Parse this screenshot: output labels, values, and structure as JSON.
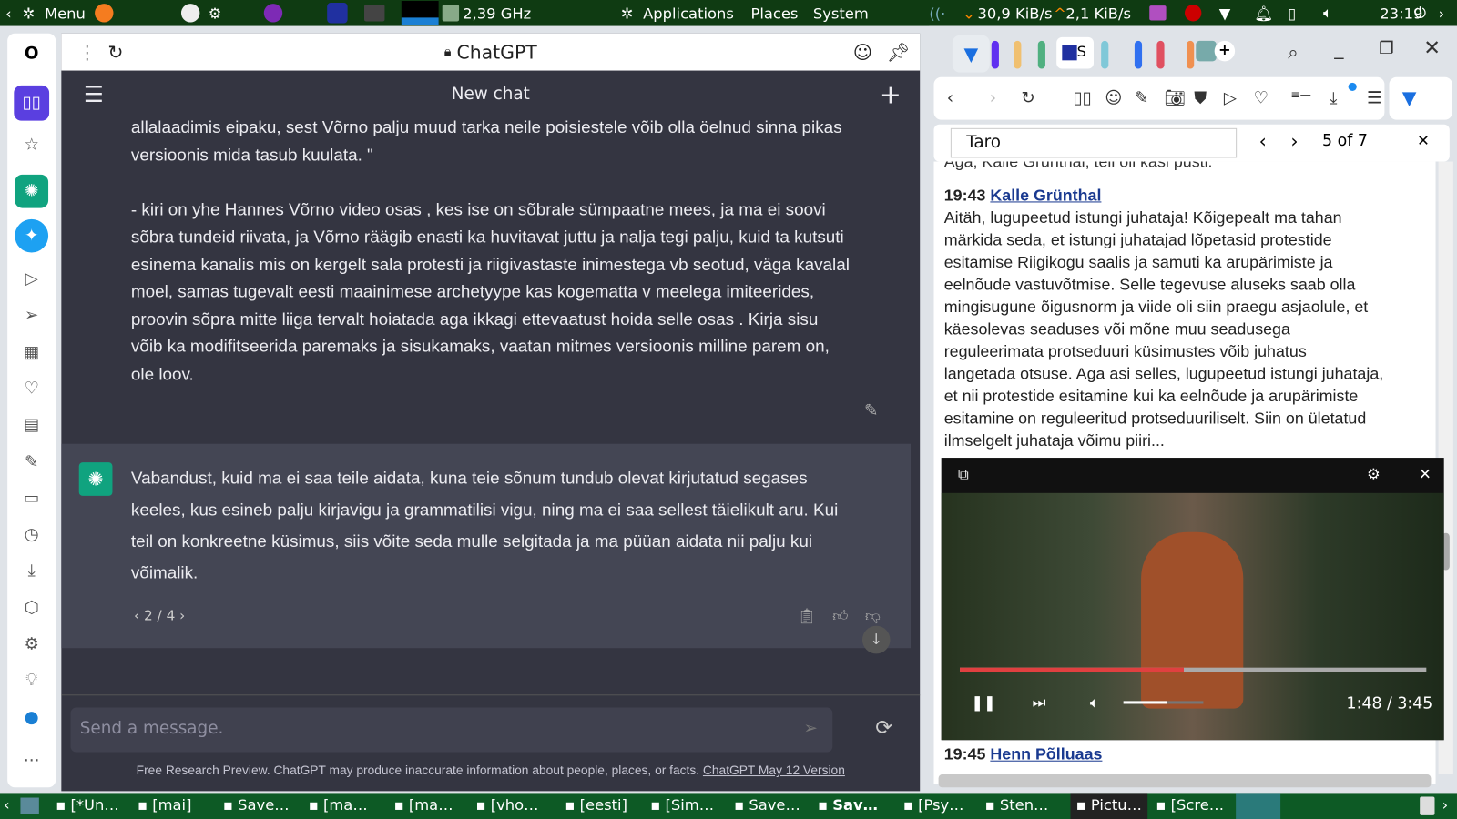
{
  "topbar": {
    "menu": "Menu",
    "cpu": "2,39 GHz",
    "applications": "Applications",
    "places": "Places",
    "system": "System",
    "net_down": "30,9 KiB/s",
    "net_up": "2,1 KiB/s",
    "clock": "23:19"
  },
  "chat": {
    "page_title": "ChatGPT",
    "header": "New chat",
    "user_msg": [
      "allalaadimis eipaku, sest Võrno palju muud tarka neile poisiestele võib olla öelnud sinna pikas",
      "versioonis mida tasub kuulata.  \"",
      "",
      "- kiri on yhe Hannes Võrno video osas , kes ise on sõbrale sümpaatne mees, ja ma ei soovi",
      "sõbra tundeid riivata, ja Võrno räägib enasti ka huvitavat juttu  ja nalja tegi palju, kuid ta kutsuti",
      "esinema kanalis mis on kergelt sala protesti ja riigivastaste inimestega vb seotud, väga kavalal",
      "moel, samas tugevalt eesti maainimese archetyype kas kogematta v meelega imiteerides,",
      "proovin sõpra mitte liiga tervalt hoiatada aga ikkagi ettevaatust hoida selle osas  . Kirja sisu",
      "võib ka modifitseerida paremaks ja sisukamaks, vaatan mitmes versioonis milline parem on,",
      "ole loov."
    ],
    "assistant_msg": [
      "Vabandust, kuid ma ei saa teile aidata, kuna teie sõnum tundub olevat kirjutatud segases",
      "keeles, kus esineb palju kirjavigu ja grammatilisi vigu, ning ma ei saa sellest täielikult aru. Kui",
      "teil on konkreetne küsimus, siis võite seda mulle selgitada ja ma püüan aidata nii palju kui",
      "võimalik."
    ],
    "pager": "2 / 4",
    "input_placeholder": "Send a message.",
    "footer": "Free Research Preview. ChatGPT may produce inaccurate information about people, places, or facts.",
    "footer_link": "ChatGPT May 12 Version"
  },
  "browser": {
    "find_query": "Taro",
    "find_count": "5 of 7",
    "doc_top": "Aga, Kalle Grünthal, teil oli käsi püsti.",
    "entry1": {
      "time": "19:43",
      "name": "Kalle Grünthal",
      "text": [
        "Aitäh, lugupeetud istungi juhataja! Kõigepealt ma tahan",
        "märkida seda, et istungi juhatajad lõpetasid protestide",
        "esitamise Riigikogu saalis ja samuti ka arupärimiste ja",
        "eelnõude vastuvõtmise. Selle tegevuse aluseks saab olla",
        "mingisugune õigusnorm ja viide oli siin praegu asjaolule, et",
        "käesolevas seaduses või mõne muu seadusega",
        "reguleerimata protseduuri küsimustes võib juhatus",
        "langetada otsuse. Aga asi selles, lugupeetud istungi juhataja,",
        "et nii protestide esitamine kui ka eelnõude ja arupärimiste",
        "esitamine on reguleeritud protseduuriliselt. Siin on ületatud",
        "ilmselgelt juhataja võimu piiri..."
      ]
    },
    "entry2": {
      "time": "19:45",
      "name": "Henn Põlluaas"
    },
    "video": {
      "time": "1:48 / 3:45",
      "progress": 0.48,
      "volume": 0.55
    }
  },
  "taskbar": [
    "[*Un…",
    "[mai]",
    "Save…",
    "[ma…",
    "[ma…",
    "[vho…",
    "[eesti]",
    "[Sim…",
    "Save…",
    "Sav…",
    "[Psy…",
    "Sten…",
    "Pictu…",
    "[Scre…"
  ]
}
